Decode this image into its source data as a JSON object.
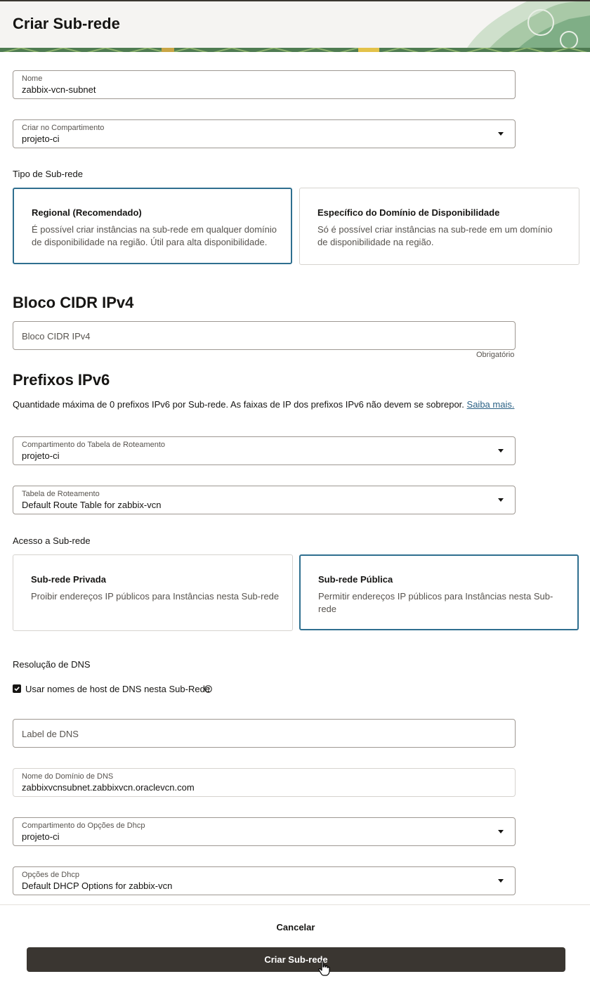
{
  "header": {
    "title": "Criar Sub-rede"
  },
  "name_field": {
    "label": "Nome",
    "value": "zabbix-vcn-subnet"
  },
  "compartment_field": {
    "label": "Criar no Compartimento",
    "value": "projeto-ci"
  },
  "subnet_type": {
    "label": "Tipo de Sub-rede",
    "options": [
      {
        "title": "Regional (Recomendado)",
        "description": "É possível criar instâncias na sub-rede em qualquer domínio de disponibilidade na região. Útil para alta disponibilidade.",
        "selected": true
      },
      {
        "title": "Específico do Domínio de Disponibilidade",
        "description": "Só é possível criar instâncias na sub-rede em um domínio de disponibilidade na região.",
        "selected": false
      }
    ]
  },
  "ipv4": {
    "heading": "Bloco CIDR IPv4",
    "placeholder": "Bloco CIDR IPv4",
    "required_note": "Obrigatório"
  },
  "ipv6": {
    "heading": "Prefixos IPv6",
    "info": "Quantidade máxima de 0 prefixos IPv6 por Sub-rede. As faixas de IP dos prefixos IPv6 não devem se sobrepor.",
    "link": "Saiba mais."
  },
  "route_table_compartment": {
    "label": "Compartimento do Tabela de Roteamento",
    "value": "projeto-ci"
  },
  "route_table": {
    "label": "Tabela de Roteamento",
    "value": "Default Route Table for zabbix-vcn"
  },
  "subnet_access": {
    "label": "Acesso a Sub-rede",
    "options": [
      {
        "title": "Sub-rede Privada",
        "description": "Proibir endereços IP públicos para Instâncias nesta Sub-rede",
        "selected": false
      },
      {
        "title": "Sub-rede Pública",
        "description": "Permitir endereços IP públicos para Instâncias nesta Sub-rede",
        "selected": true
      }
    ]
  },
  "dns": {
    "label": "Resolução de DNS",
    "checkbox_label": "Usar nomes de host de DNS nesta Sub-Rede",
    "checked": true,
    "dns_label_placeholder": "Label de DNS",
    "domain_label": "Nome do Domínio de DNS",
    "domain_value": "zabbixvcnsubnet.zabbixvcn.oraclevcn.com"
  },
  "dhcp_compartment": {
    "label": "Compartimento do Opções de Dhcp",
    "value": "projeto-ci"
  },
  "dhcp_options": {
    "label": "Opções de Dhcp",
    "value": "Default DHCP Options for zabbix-vcn"
  },
  "footer": {
    "cancel_label": "Cancelar",
    "submit_label": "Criar Sub-rede"
  },
  "colors": {
    "selected_border": "#2f6f8f",
    "primary_button": "#3a3631",
    "link": "#2b6286"
  }
}
